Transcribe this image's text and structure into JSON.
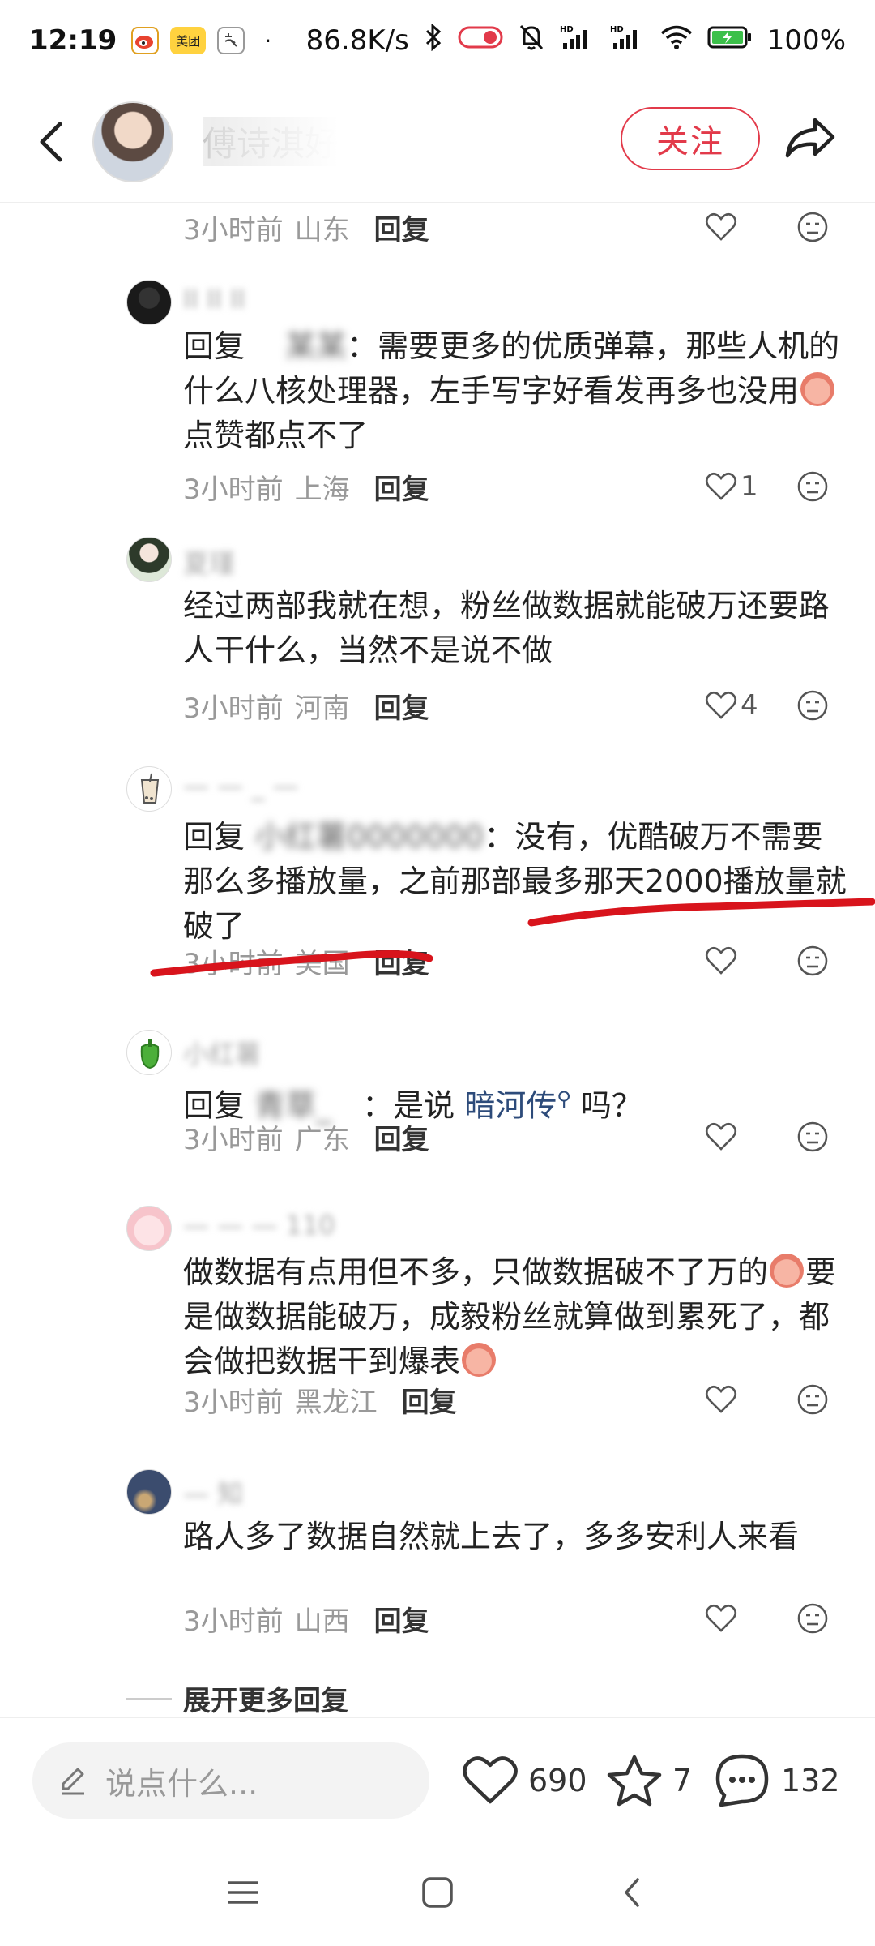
{
  "status_bar": {
    "time": "12:19",
    "apps": [
      "weibo-icon",
      "meituan-icon",
      "tiktok-icon"
    ],
    "meituan_label": "美团",
    "dot": "·",
    "net_speed": "86.8K/s",
    "battery": "100%"
  },
  "header": {
    "author": "傅诗淇好",
    "follow_label": "关注"
  },
  "comments": [
    {
      "name": "",
      "text_parts": [],
      "time": "3小时前",
      "location": "山东",
      "reply_label": "回复",
      "likes": ""
    },
    {
      "name": "",
      "reply_prefix": "回复",
      "reply_target": "",
      "text": "：需要更多的优质弹幕，那些人机的什么八核处理器，左手写字好看发再多也没用",
      "text_after_emoji": "点赞都点不了",
      "time": "3小时前",
      "location": "上海",
      "reply_label": "回复",
      "likes": "1"
    },
    {
      "name": "夏瑾",
      "text": "经过两部我就在想，粉丝做数据就能破万还要路人干什么，当然不是说不做",
      "time": "3小时前",
      "location": "河南",
      "reply_label": "回复",
      "likes": "4"
    },
    {
      "name": "",
      "reply_prefix": "回复",
      "reply_target": "小红薯",
      "text": "：没有，优酷破万不需要那么多播放量，之前那部最多那天2000播放量就破了",
      "time": "3小时前",
      "location": "美国",
      "reply_label": "回复",
      "likes": ""
    },
    {
      "name": "小红薯",
      "reply_prefix": "回复",
      "reply_target": "青",
      "text_before_link": "：是说 ",
      "link": "暗河传",
      "text_after_link": " 吗？",
      "time": "3小时前",
      "location": "广东",
      "reply_label": "回复",
      "likes": ""
    },
    {
      "name": "",
      "text_a": "做数据有点用但不多，只做数据破不了万的",
      "text_b": "要是做数据能破万，成毅粉丝就算做到累死了，都会做把数据干到爆表",
      "time": "3小时前",
      "location": "黑龙江",
      "reply_label": "回复",
      "likes": ""
    },
    {
      "name": "",
      "text": "路人多了数据自然就上去了，多多安利人来看",
      "time": "3小时前",
      "location": "山西",
      "reply_label": "回复",
      "likes": ""
    }
  ],
  "more_replies": "展开更多回复",
  "bottom_bar": {
    "input_placeholder": "说点什么...",
    "likes": "690",
    "favorites": "7",
    "comments": "132"
  }
}
